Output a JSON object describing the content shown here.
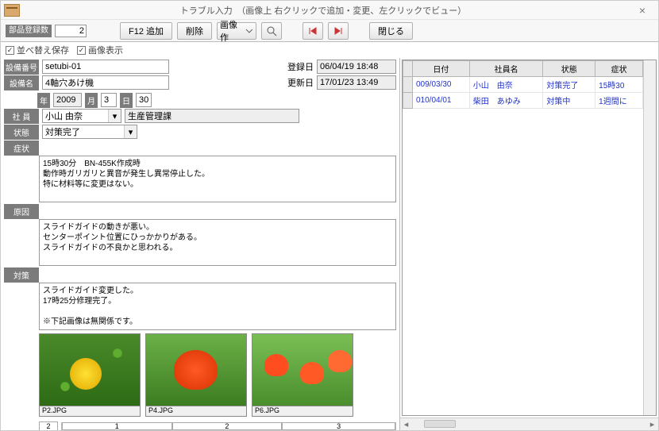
{
  "window": {
    "title": "トラブル入力　（画像上 右クリックで追加・変更、左クリックでビュー）"
  },
  "toolbar": {
    "parts_label": "部品登録数",
    "parts_count": "2",
    "f12_add": "F12 追加",
    "delete": "削除",
    "image_combo": "画像作",
    "close": "閉じる",
    "sort_save": "並べ替え保存",
    "image_show": "画像表示"
  },
  "header": {
    "equip_no_label": "設備番号",
    "equip_no": "setubi-01",
    "equip_name_label": "設備名",
    "equip_name": "4軸穴あけ機",
    "reg_date_label": "登録日",
    "reg_date": "06/04/19 18:48",
    "upd_date_label": "更新日",
    "upd_date": "17/01/23 13:49"
  },
  "date": {
    "year_label": "年",
    "year": "2009",
    "month_label": "月",
    "month": "3",
    "day_label": "日",
    "day": "30"
  },
  "employee": {
    "label": "社 員",
    "name": "小山 由奈",
    "dept": "生産管理課"
  },
  "status": {
    "label": "状態",
    "value": "対策完了"
  },
  "sections": {
    "symptom": {
      "label": "症状",
      "text": "15時30分　BN-455K作成時\n動作時ガリガリと異音が発生し異常停止した。\n特に材料等に変更はない。"
    },
    "cause": {
      "label": "原因",
      "text": "スライドガイドの動きが悪い。\nセンターポイント位置にひっかかりがある。\nスライドガイドの不良かと思われる。"
    },
    "action": {
      "label": "対策",
      "text": "スライドガイド変更した。\n17時25分修理完了。\n\n※下記画像は無関係です。"
    }
  },
  "thumbs": [
    {
      "caption": "P2.JPG"
    },
    {
      "caption": "P4.JPG"
    },
    {
      "caption": "P6.JPG"
    }
  ],
  "thumb_scroll": {
    "z": "2",
    "seg1": "1",
    "seg2": "2",
    "seg3": "3"
  },
  "grid": {
    "columns": [
      "日付",
      "社員名",
      "状態",
      "症状"
    ],
    "rows": [
      {
        "date": "009/03/30",
        "emp": "小山　由奈",
        "status": "対策完了",
        "symptom": "15時30"
      },
      {
        "date": "010/04/01",
        "emp": "柴田　あゆみ",
        "status": "対策中",
        "symptom": "1週間に"
      }
    ]
  }
}
